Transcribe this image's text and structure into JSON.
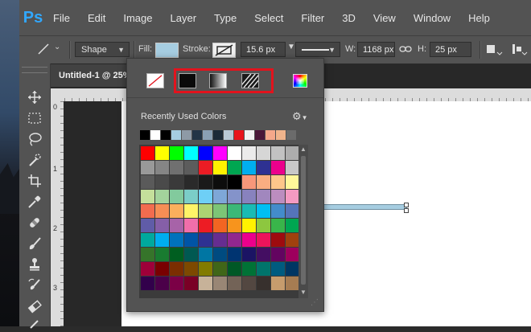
{
  "app": {
    "logo": "Ps"
  },
  "menu": [
    "File",
    "Edit",
    "Image",
    "Layer",
    "Type",
    "Select",
    "Filter",
    "3D",
    "View",
    "Window",
    "Help"
  ],
  "options": {
    "tool_icon": "line-tool-icon",
    "mode_value": "Shape",
    "fill_label": "Fill:",
    "fill_color": "#a6cde1",
    "stroke_label": "Stroke:",
    "stroke_width": "15.6 px",
    "w_label": "W:",
    "w_value": "1168 px",
    "h_label": "H:",
    "h_value": "25 px"
  },
  "document": {
    "tab_title": "Untitled-1 @ 25%",
    "ruler_left_numbers": [
      "0",
      "1",
      "2",
      "3"
    ]
  },
  "swatch_popup": {
    "fill_types": [
      "no-color",
      "solid-color",
      "gradient",
      "pattern"
    ],
    "picker_icon": "color-picker-icon",
    "recent_label": "Recently Used Colors",
    "settings_icon": "gear-icon",
    "recent_colors": [
      "#000000",
      "#ffffff",
      "#000000",
      "#a6cde1",
      "#8e9aa6",
      "#223446",
      "#8aa0b4",
      "#1c2a38",
      "#b8c8d6",
      "#e8141c",
      "#f2f2f2",
      "#4a1838",
      "#f5a88a",
      "#f0b48c",
      "#6b6b6b"
    ],
    "colors": [
      "#ff0000",
      "#ffff00",
      "#00ff00",
      "#00ffff",
      "#0000ff",
      "#ff00ff",
      "#ffffff",
      "#ebebeb",
      "#d6d6d6",
      "#c2c2c2",
      "#adadad",
      "#999999",
      "#858585",
      "#707070",
      "#5c5c5c",
      "#eb1c24",
      "#fff200",
      "#00a651",
      "#00aeef",
      "#2e3192",
      "#ec008c",
      "#c8c8c8",
      "#5a5a5a",
      "#4a4a4a",
      "#3a3a3a",
      "#2a2a2a",
      "#1a1a1a",
      "#0d0d0d",
      "#000000",
      "#f7977a",
      "#f9ad81",
      "#fdc68a",
      "#fff79a",
      "#c4df9b",
      "#a3d39c",
      "#82ca9d",
      "#7bcdc8",
      "#6ecff6",
      "#7ea7d8",
      "#8493ca",
      "#8882be",
      "#a187be",
      "#bc8dbf",
      "#f49ac2",
      "#f26c4f",
      "#f68e55",
      "#fbaf5c",
      "#fff467",
      "#acd372",
      "#7cc576",
      "#3bb878",
      "#1abbb4",
      "#00bff3",
      "#438ccb",
      "#5574b9",
      "#605ca8",
      "#855fa8",
      "#a763a8",
      "#f06eaa",
      "#ed1c24",
      "#f26522",
      "#f7941d",
      "#fff200",
      "#8dc73f",
      "#39b54a",
      "#00a651",
      "#00a99d",
      "#00aeef",
      "#0072bc",
      "#0054a6",
      "#2e3192",
      "#662d91",
      "#92278f",
      "#ec008c",
      "#ed145b",
      "#9e0b0f",
      "#a0410d",
      "#36742a",
      "#197b30",
      "#005e20",
      "#005952",
      "#0076a3",
      "#004b80",
      "#003471",
      "#1b1464",
      "#440e62",
      "#630460",
      "#9e005d",
      "#9e0039",
      "#790000",
      "#7b2e00",
      "#7d4900",
      "#827b00",
      "#406618",
      "#005826",
      "#007236",
      "#00746b",
      "#005b7f",
      "#003663",
      "#32004b",
      "#4b0049",
      "#7b0046",
      "#7a0026",
      "#c7b299",
      "#998675",
      "#736357",
      "#534741",
      "#37302d",
      "#c69c6d",
      "#a67c52"
    ]
  }
}
